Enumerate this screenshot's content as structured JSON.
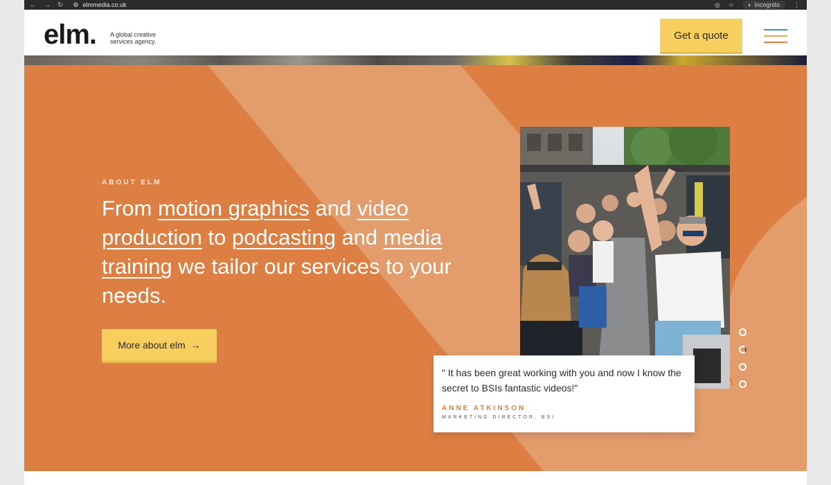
{
  "browser": {
    "url": "elmmedia.co.uk",
    "mode_label": "Incognito"
  },
  "header": {
    "logo": "elm.",
    "tagline": "A global creative services agency.",
    "cta_label": "Get a quote"
  },
  "hero": {
    "eyebrow": "ABOUT ELM",
    "headline": {
      "prefix": "From ",
      "link1": "motion graphics",
      "mid1": " and ",
      "link2": "video production",
      "mid2": " to ",
      "link3": "podcasting",
      "mid3": " and ",
      "link4": "media training",
      "suffix": " we tailor our services to your needs."
    },
    "button_label": "More about elm",
    "button_arrow": "→"
  },
  "testimonial": {
    "quote": "\" It has been great working with you and now I know the secret to BSIs fantastic videos!\"",
    "name": "ANNE ATKINSON",
    "role": "MARKETING DIRECTOR, BSI"
  },
  "carousel": {
    "count": 4,
    "active_index": 1
  },
  "colors": {
    "hero_orange": "#dd7f42",
    "accent_yellow": "#f7cf5e",
    "menu_lines": [
      "#3e8fb0",
      "#e3a85a",
      "#dd7f42"
    ]
  }
}
